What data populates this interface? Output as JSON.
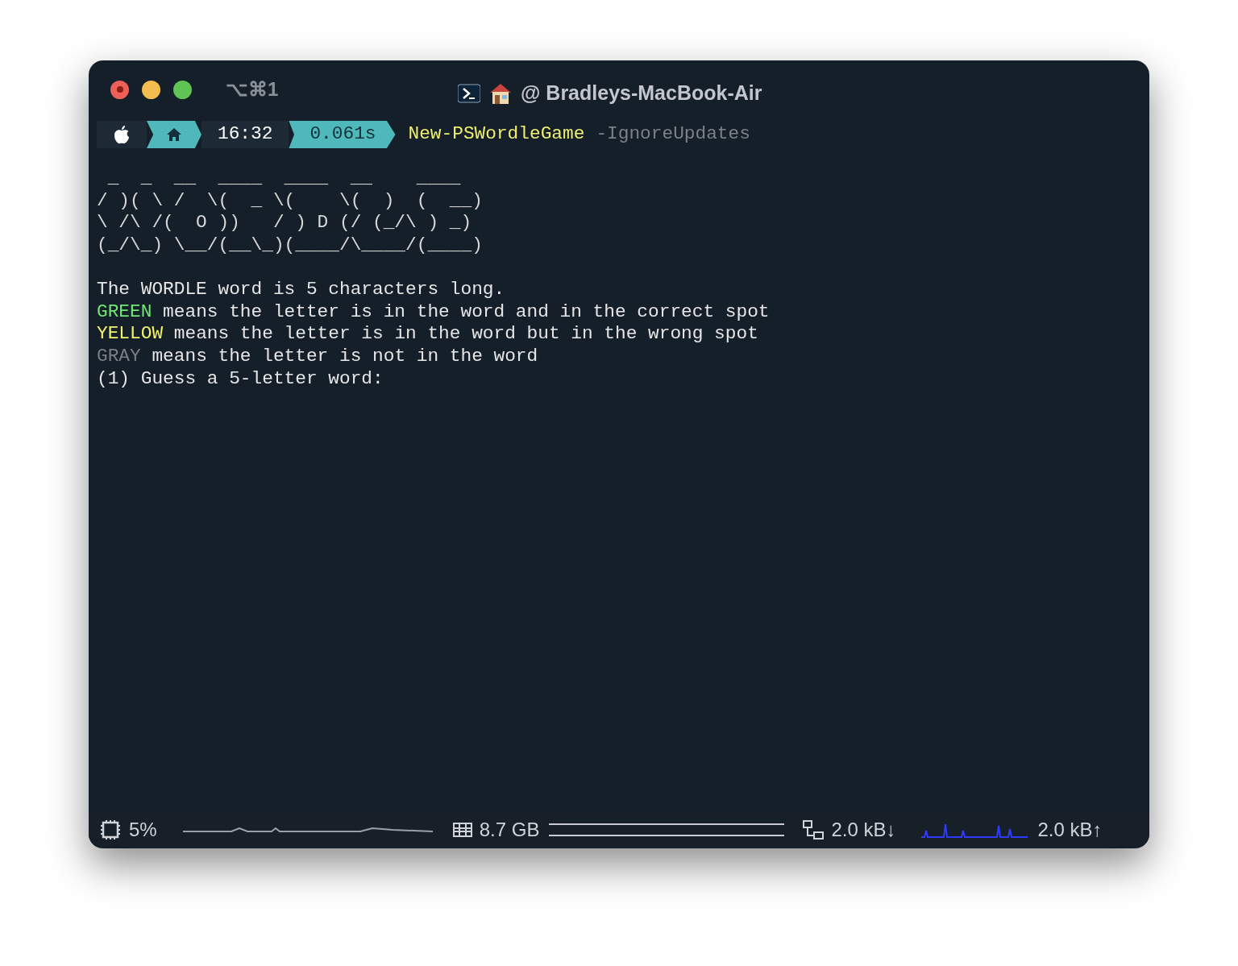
{
  "window": {
    "tab_shortcut": "⌥⌘1",
    "title": "@ Bradleys-MacBook-Air"
  },
  "prompt": {
    "segments": [
      {
        "kind": "apple"
      },
      {
        "kind": "home"
      },
      {
        "kind": "text",
        "text": "16:32"
      },
      {
        "kind": "accent",
        "text": "0.061s"
      }
    ],
    "command": "New-PSWordleGame",
    "argument": "-IgnoreUpdates"
  },
  "banner": [
    " _  _  __  ____  ____  __    ____",
    "/ )( \\ /  \\(  _ \\(    \\(  )  (  __)",
    "\\ /\\ /(  O ))   / ) D (/ (_/\\ ) _)",
    "(_/\\_) \\__/(__\\_)(____/\\____/(____)"
  ],
  "output": [
    {
      "kind": "plain",
      "text": "The WORDLE word is 5 characters long."
    },
    {
      "kind": "green",
      "lead": "GREEN",
      "text": " means the letter is in the word and in the correct spot"
    },
    {
      "kind": "yellow",
      "lead": "YELLOW",
      "text": " means the letter is in the word but in the wrong spot"
    },
    {
      "kind": "gray",
      "lead": "GRAY",
      "text": " means the letter is not in the word"
    },
    {
      "kind": "plain",
      "text": "(1) Guess a 5-letter word:"
    }
  ],
  "status_bar": {
    "cpu": "5%",
    "memory": "8.7 GB",
    "download": "2.0 kB↓",
    "upload": "2.0 kB↑"
  }
}
